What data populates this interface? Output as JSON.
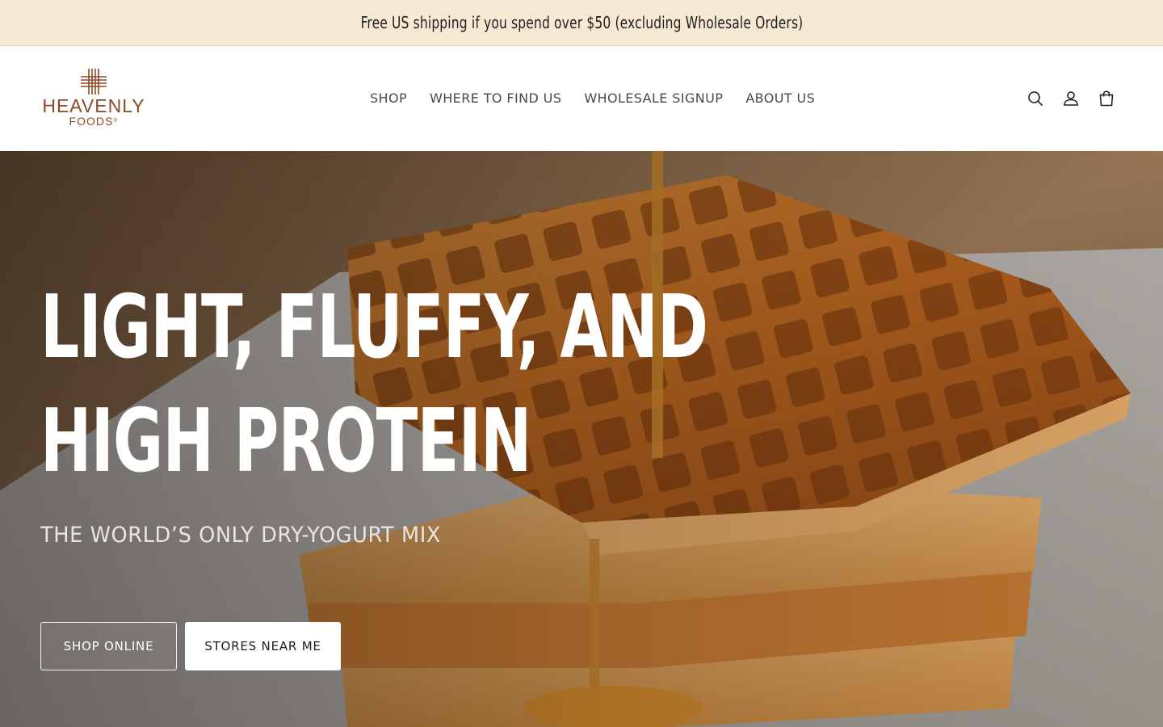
{
  "announcement": {
    "text": "Free US shipping if you spend over $50 (excluding Wholesale Orders)"
  },
  "header": {
    "logo": {
      "brand": "HEAVENLY",
      "sub": "FOODS",
      "mark_icon": "waffle-grid-icon",
      "color": "#8a4a26"
    },
    "nav": [
      {
        "label": "SHOP"
      },
      {
        "label": "WHERE TO FIND US"
      },
      {
        "label": "WHOLESALE SIGNUP"
      },
      {
        "label": "ABOUT US"
      }
    ],
    "icons": [
      "search-icon",
      "account-icon",
      "cart-icon"
    ]
  },
  "hero": {
    "title_line1": "LIGHT, FLUFFY, AND",
    "title_line2": "HIGH PROTEIN",
    "subtitle": "THE WORLD’S ONLY DRY-YOGURT MIX",
    "buttons": {
      "shop_online": "SHOP ONLINE",
      "stores_near_me": "STORES NEAR ME"
    }
  },
  "colors": {
    "announcement_bg": "#f5e9d3",
    "header_bg": "#ffffff",
    "hero_text": "#ffffff",
    "logo_brown": "#8a4a26"
  }
}
